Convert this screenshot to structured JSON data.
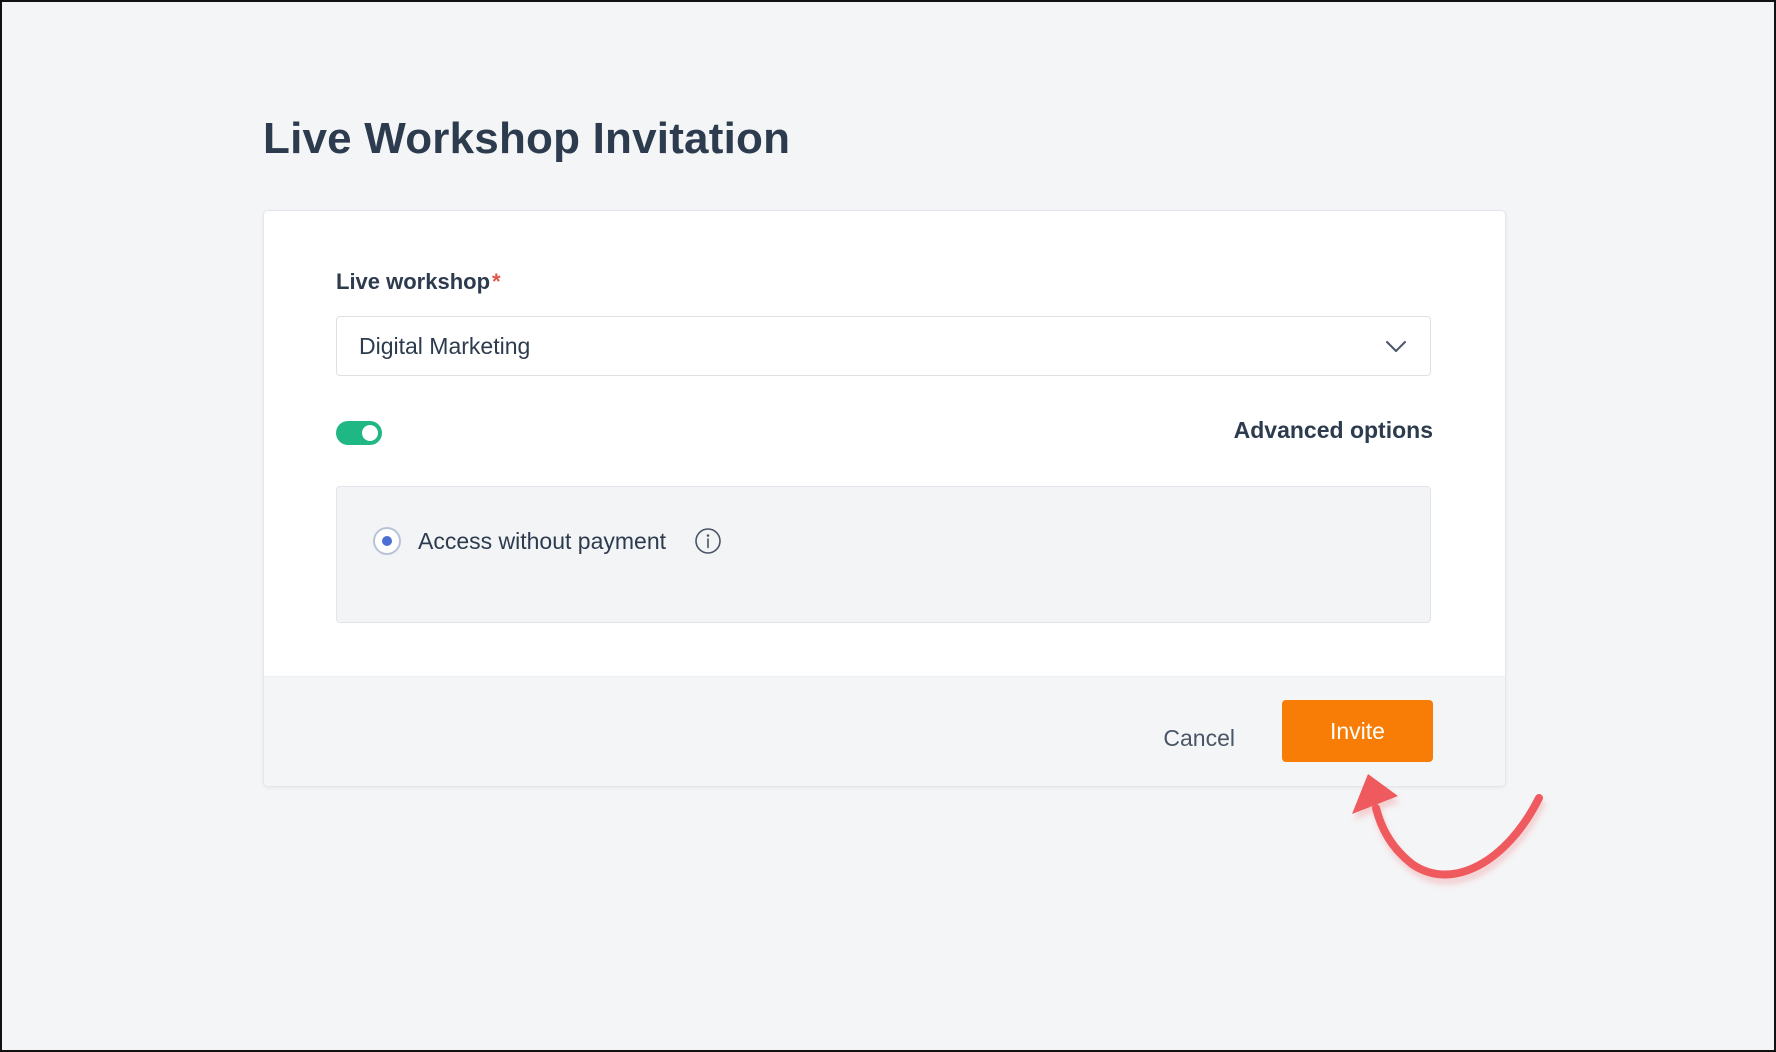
{
  "page": {
    "title": "Live Workshop Invitation"
  },
  "form": {
    "workshop_label": "Live workshop",
    "required_mark": "*",
    "workshop_selected": "Digital Marketing",
    "toggle_on": true,
    "advanced_label": "Advanced options",
    "access_option_label": "Access without payment",
    "access_option_selected": true
  },
  "footer": {
    "cancel_label": "Cancel",
    "invite_label": "Invite"
  },
  "icons": {
    "select_arrow": "chevron-down-icon",
    "info": "info-icon",
    "annotation": "curved-arrow-icon"
  },
  "colors": {
    "primary_button": "#f77d06",
    "toggle_active": "#1fb885",
    "radio_selected": "#4a6fd6",
    "required_star": "#e0564b",
    "annotation_arrow": "#ef5a5f"
  }
}
